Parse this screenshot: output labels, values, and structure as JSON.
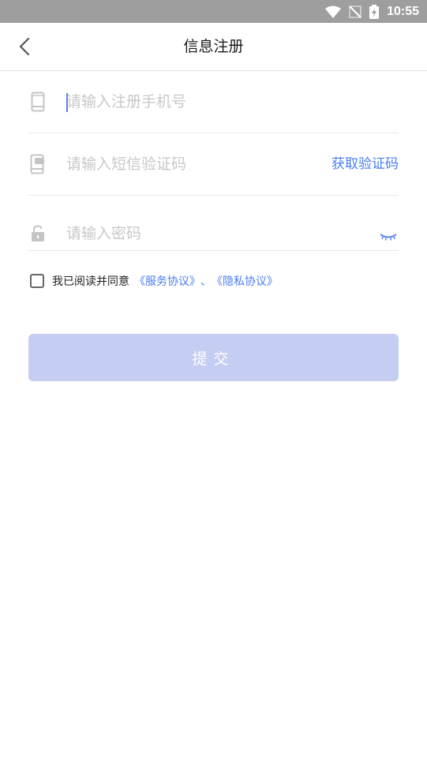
{
  "status_bar": {
    "time": "10:55"
  },
  "header": {
    "title": "信息注册"
  },
  "form": {
    "phone": {
      "placeholder": "请输入注册手机号",
      "value": ""
    },
    "sms_code": {
      "placeholder": "请输入短信验证码",
      "value": "",
      "get_code_label": "获取验证码"
    },
    "password": {
      "placeholder": "请输入密码",
      "value": ""
    },
    "agreement": {
      "prefix": "我已阅读并同意",
      "service_link": "《服务协议》",
      "separator": "、",
      "privacy_link": "《隐私协议》"
    },
    "submit_label": "提交"
  },
  "colors": {
    "accent": "#4a7cf0",
    "submit_disabled": "#c5cef2",
    "status_bar": "#9e9e9e"
  }
}
